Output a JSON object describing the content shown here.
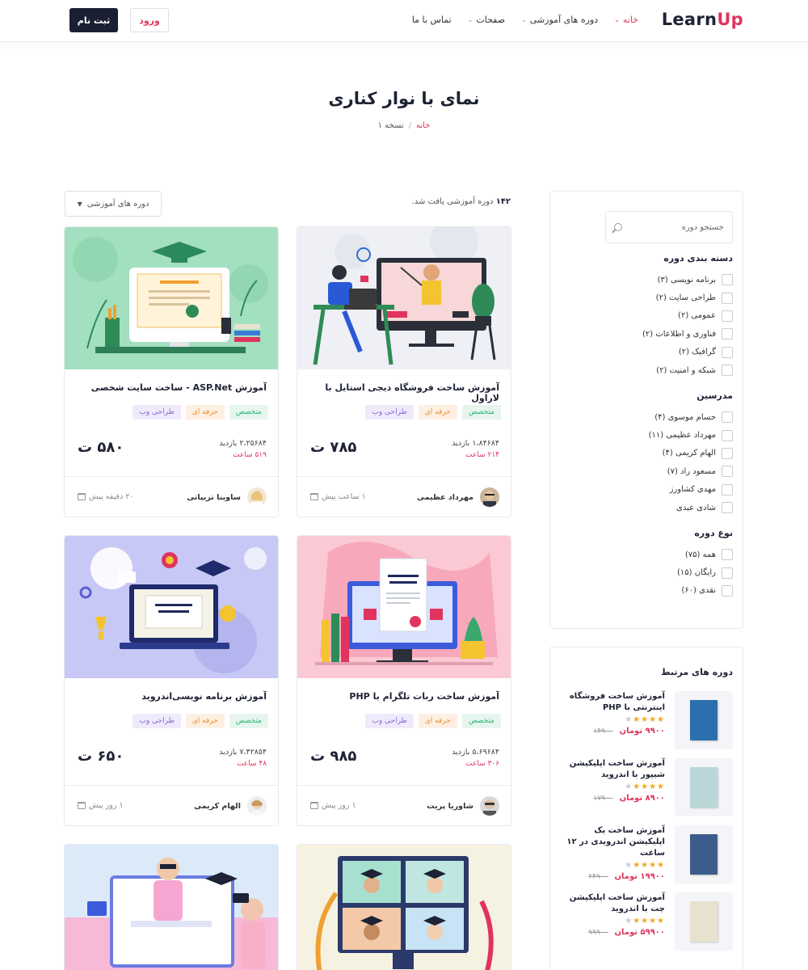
{
  "header": {
    "logo_part1": "Learn",
    "logo_part2": "Up",
    "nav": [
      {
        "label": "خانه",
        "active": true,
        "has_dropdown": true
      },
      {
        "label": "دوره های آموزشی",
        "active": false,
        "has_dropdown": true
      },
      {
        "label": "صفحات",
        "active": false,
        "has_dropdown": true
      },
      {
        "label": "تماس با ما",
        "active": false,
        "has_dropdown": false
      }
    ],
    "login_label": "ورود",
    "register_label": "ثبت نام"
  },
  "page": {
    "title": "نمای با نوار کناری",
    "breadcrumb_home": "خانه",
    "breadcrumb_sep": "/",
    "breadcrumb_current": "نسخه ۱"
  },
  "results": {
    "count": "۱۴۲",
    "text": "دوره آموزشی یافت شد.",
    "sort_label": "دوره های آموزشی"
  },
  "courses": [
    {
      "title": "آموزش ساخت فروشگاه دیجی استایل با لاراول",
      "tags": [
        "متخصص",
        "حرفه ای",
        "طراحی وب"
      ],
      "views": "۱،۸۴۶۸۴ بازدید",
      "hours": "۲۱۴ ساعت",
      "price": "۷۸۵ ت",
      "author": "مهرداد عظیمی",
      "time": "۱ ساعت پیش"
    },
    {
      "title": "آموزش ASP.Net - ساخت سایت شخصی",
      "tags": [
        "متخصص",
        "حرفه ای",
        "طراحی وب"
      ],
      "views": "۲،۲۵۶۸۴ بازدید",
      "hours": "۵۱۹ ساعت",
      "price": "۵۸۰ ت",
      "author": "ساوینا تریپاتی",
      "time": "۲۰ دقیقه پیش"
    },
    {
      "title": "آموزش ساخت ربات تلگرام با PHP",
      "tags": [
        "متخصص",
        "حرفه ای",
        "طراحی وب"
      ],
      "views": "۵،۶۹۶۸۴ بازدید",
      "hours": "۳۰۶ ساعت",
      "price": "۹۸۵ ت",
      "author": "شاوریا پریت",
      "time": "۱ روز پیش"
    },
    {
      "title": "آموزش برنامه نویسی‌اندروید",
      "tags": [
        "متخصص",
        "حرفه ای",
        "طراحی وب"
      ],
      "views": "۷،۴۲۸۵۴ بازدید",
      "hours": "۴۸ ساعت",
      "price": "۶۵۰ ت",
      "author": "الهام کریمی",
      "time": "۱ روز پیش"
    }
  ],
  "filters": {
    "search_placeholder": "جستجو دوره",
    "categories_heading": "دسته بندی دوره",
    "categories": [
      "برنامه نویسی (۳)",
      "طراحی سایت (۲)",
      "عمومی (۲)",
      "فناوری و اطلاعات (۲)",
      "گرافیک (۲)",
      "شبکه و امنیت (۲)"
    ],
    "teachers_heading": "مدرسین",
    "teachers": [
      "حسام موسوی (۴)",
      "مهرداد عظیمی (۱۱)",
      "الهام کریمی (۴)",
      "مسعود راد (۷)",
      "مهدی کشاورز",
      "شادی عبدی"
    ],
    "type_heading": "نوع دوره",
    "types": [
      "همه (۷۵)",
      "رایگان (۱۵)",
      "نقدی (۶۰)"
    ]
  },
  "related": {
    "heading": "دوره های مرتبط",
    "items": [
      {
        "name": "آموزش ساخت فروشگاه اینترنتی با PHP",
        "price": "۹۹۰۰ تومان",
        "old_price": "۱۴۹۰۰",
        "rating": 4,
        "book_color": "#2c6fb0",
        "book_text": "MATT HAIG"
      },
      {
        "name": "آموزش ساخت اپلیکیشن شیپور با اندروید",
        "price": "۸۹۰۰ تومان",
        "old_price": "۱۷۹۰۰",
        "rating": 4,
        "book_color": "#b9d7d9",
        "book_text": "Jodi Picoult"
      },
      {
        "name": "آموزش ساخت یک اپلیکیشن اندرویدی در ۱۲ ساعت",
        "price": "۱۹۹۰۰ تومان",
        "old_price": "۲۴۹۰۰",
        "rating": 4,
        "book_color": "#3c5d8a",
        "book_text": "KEN FOLLETT"
      },
      {
        "name": "آموزش ساخت اپلیکیشن چت با اندروید",
        "price": "۵۹۹۰۰ تومان",
        "old_price": "۹۹۹۰۰",
        "rating": 4,
        "book_color": "#e9e1cf",
        "book_text": "Charlotte's Web"
      }
    ]
  },
  "colors": {
    "accent": "#e0345e",
    "dark": "#1a1f33"
  }
}
